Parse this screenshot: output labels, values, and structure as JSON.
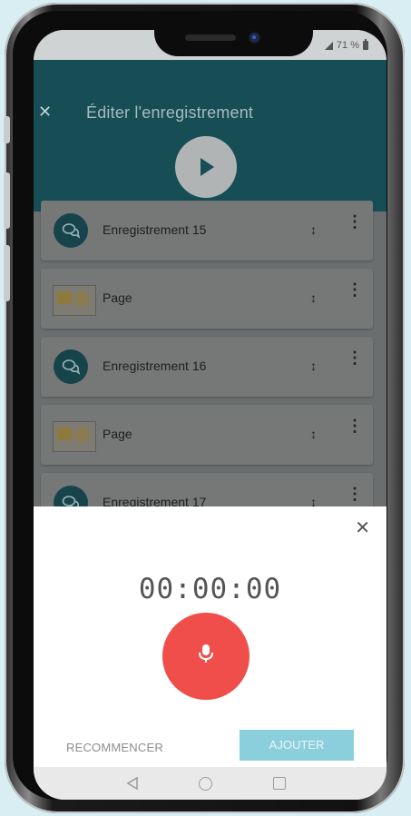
{
  "status": {
    "battery": "71 %"
  },
  "header": {
    "close_icon": "✕",
    "title": "Éditer l'enregistrement"
  },
  "list": [
    {
      "type": "recording",
      "label": "Enregistrement 15"
    },
    {
      "type": "page",
      "label": "Page"
    },
    {
      "type": "recording",
      "label": "Enregistrement 16"
    },
    {
      "type": "page",
      "label": "Page"
    },
    {
      "type": "recording",
      "label": "Enregistrement 17"
    }
  ],
  "row_icons": {
    "move": "↕",
    "more": "⋮"
  },
  "sheet": {
    "close_icon": "✕",
    "timer": "00:00:00",
    "restart_label": "RECOMMENCER",
    "add_label": "AJOUTER"
  },
  "colors": {
    "header": "#174d55",
    "record": "#ef4e4a",
    "add_button": "#8ccfdc"
  }
}
